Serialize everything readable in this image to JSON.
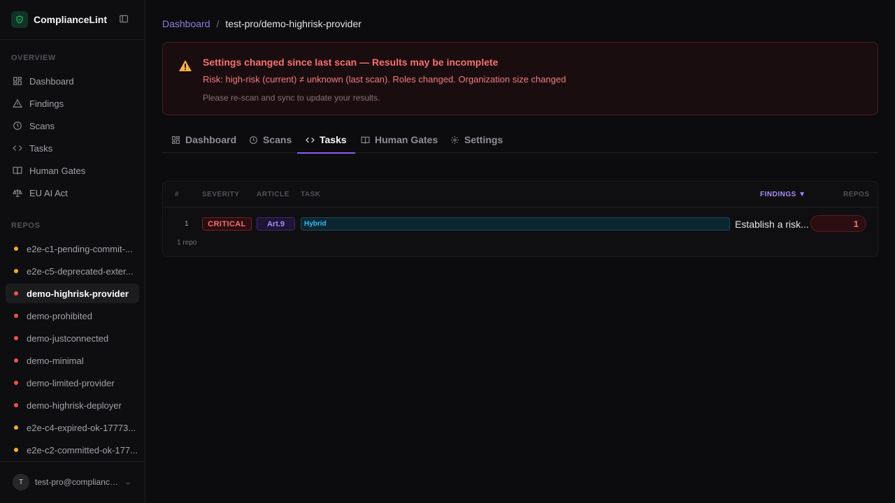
{
  "app": {
    "name": "ComplianceLint",
    "accent": "#8b5cf6"
  },
  "sidebar": {
    "overview_label": "OVERVIEW",
    "nav": [
      {
        "label": "Dashboard",
        "icon": "dashboard-icon"
      },
      {
        "label": "Findings",
        "icon": "warning-icon"
      },
      {
        "label": "Scans",
        "icon": "clock-icon"
      },
      {
        "label": "Tasks",
        "icon": "code-icon"
      },
      {
        "label": "Human Gates",
        "icon": "book-icon"
      },
      {
        "label": "EU AI Act",
        "icon": "scale-icon"
      }
    ],
    "repos_label": "REPOS",
    "repos": [
      {
        "name": "e2e-c1-pending-commit-...",
        "status": "#f5b01e"
      },
      {
        "name": "e2e-c5-deprecated-exter...",
        "status": "#f5b01e"
      },
      {
        "name": "demo-highrisk-provider",
        "status": "#ef5350",
        "active": true
      },
      {
        "name": "demo-prohibited",
        "status": "#ef5350"
      },
      {
        "name": "demo-justconnected",
        "status": "#ef5350"
      },
      {
        "name": "demo-minimal",
        "status": "#ef5350"
      },
      {
        "name": "demo-limited-provider",
        "status": "#ef5350"
      },
      {
        "name": "demo-highrisk-deployer",
        "status": "#ef5350"
      },
      {
        "name": "e2e-c4-expired-ok-17773...",
        "status": "#f5b01e"
      },
      {
        "name": "e2e-c2-committed-ok-177...",
        "status": "#f5b01e"
      }
    ],
    "user": {
      "initial": "T",
      "email": "test-pro@complianceli..."
    }
  },
  "breadcrumb": {
    "root": "Dashboard",
    "separator": "/",
    "current": "test-pro/demo-highrisk-provider"
  },
  "alert": {
    "title": "Settings changed since last scan — Results may be incomplete",
    "body": "Risk: high-risk (current) ≠ unknown (last scan). Roles changed. Organization size changed",
    "hint": "Please re-scan and sync to update your results."
  },
  "tabs": [
    {
      "label": "Dashboard",
      "icon": "dashboard-icon"
    },
    {
      "label": "Scans",
      "icon": "clock-icon"
    },
    {
      "label": "Tasks",
      "icon": "code-icon",
      "active": true
    },
    {
      "label": "Human Gates",
      "icon": "book-icon"
    },
    {
      "label": "Settings",
      "icon": "gear-icon"
    }
  ],
  "table": {
    "headers": {
      "num": "#",
      "severity": "SEVERITY",
      "article": "ARTICLE",
      "task": "TASK",
      "findings": "FINDINGS",
      "sort_indicator": "▼",
      "repos": "REPOS"
    },
    "rows": [
      {
        "num": "1",
        "severity": "CRITICAL",
        "article": "Art.9",
        "task_tag": "Hybrid",
        "task_title": "Establish a risk...",
        "findings": "1"
      }
    ],
    "footer": "1 repo"
  }
}
